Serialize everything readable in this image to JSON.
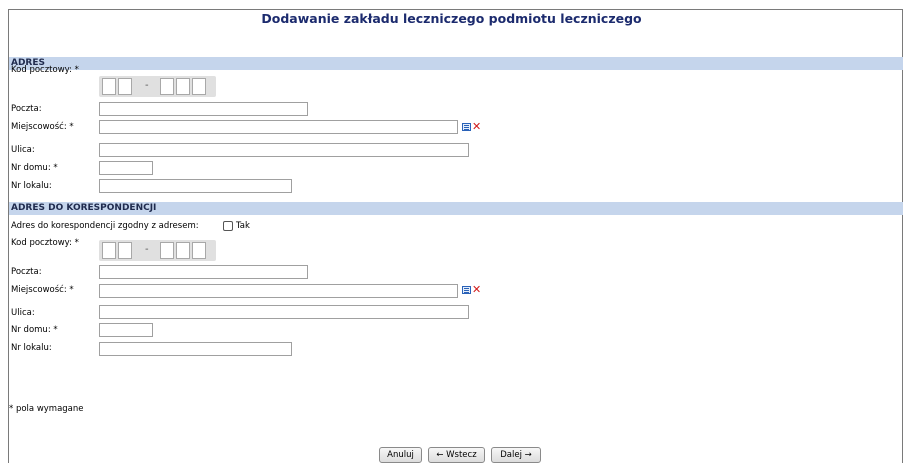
{
  "page": {
    "title": "Dodawanie zakładu leczniczego podmiotu leczniczego"
  },
  "address": {
    "header": "ADRES",
    "postal_label": "Kod pocztowy: *",
    "post_office_label": "Poczta:",
    "city_label": "Miejscowość: *",
    "street_label": "Ulica:",
    "house_label": "Nr domu: *",
    "apartment_label": "Nr lokalu:",
    "postal_separator": "-"
  },
  "correspondence": {
    "header": "ADRES DO KORESPONDENCJI",
    "same_label": "Adres do korespondencji zgodny z adresem:",
    "same_option": "Tak",
    "postal_label": "Kod pocztowy: *",
    "post_office_label": "Poczta:",
    "city_label": "Miejscowość: *",
    "street_label": "Ulica:",
    "house_label": "Nr domu: *",
    "apartment_label": "Nr lokalu:",
    "postal_separator": "-"
  },
  "footer": {
    "required_note": "* pola wymagane"
  },
  "buttons": {
    "cancel": "Anuluj",
    "back": "← Wstecz",
    "next": "Dalej →"
  },
  "icons": {
    "list": "list-icon",
    "clear": "clear-icon"
  },
  "colors": {
    "title": "#1c2b6e",
    "section_bg": "#c5d5ec",
    "clear_icon": "#d11a1a"
  }
}
